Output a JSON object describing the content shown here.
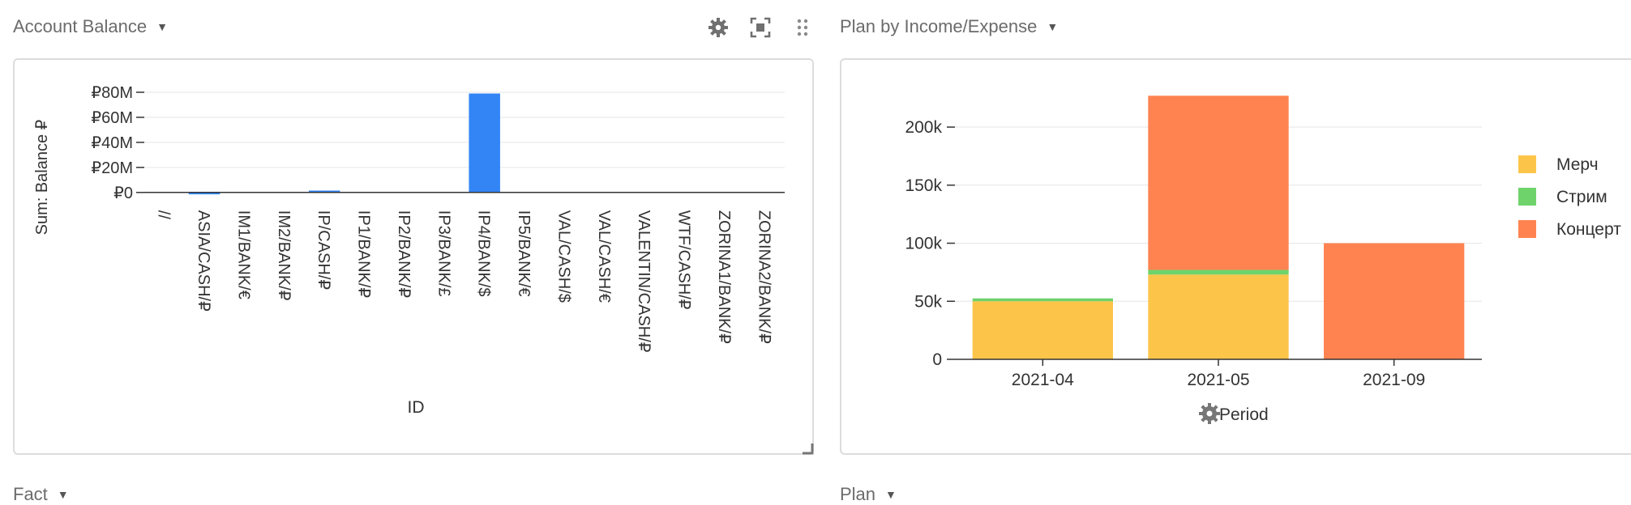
{
  "widgets": {
    "account_balance": {
      "title": "Account Balance"
    },
    "plan_income_expense": {
      "title": "Plan by Income/Expense"
    },
    "fact": {
      "title": "Fact"
    },
    "plan": {
      "title": "Plan"
    }
  },
  "toolbar": {
    "icons": [
      "gear-icon",
      "focus-icon",
      "drag-handle-icon"
    ]
  },
  "colors": {
    "bar_blue": "#3385f6",
    "merch": "#fcc54a",
    "stream": "#6fd36b",
    "concert": "#ff8350",
    "grid": "#e6e6e6",
    "axis": "#333333"
  },
  "chart_data": [
    {
      "type": "bar",
      "title": "Account Balance",
      "xlabel": "ID",
      "ylabel": "Sum: Balance ₽",
      "ylim": [
        -4000000,
        80000000
      ],
      "yticks": [
        0,
        20000000,
        40000000,
        60000000,
        80000000
      ],
      "ytick_labels": [
        "₽0",
        "₽20M",
        "₽40M",
        "₽60M",
        "₽80M"
      ],
      "categories": [
        "//",
        "ASIA/CASH/₽",
        "IM1/BANK/€",
        "IM2/BANK/₽",
        "IP/CASH/₽",
        "IP1/BANK/₽",
        "IP2/BANK/₽",
        "IP3/BANK/£",
        "IP4/BANK/$",
        "IP5/BANK/€",
        "VAL/CASH/$",
        "VAL/CASH/€",
        "VALENTIN/CASH/₽",
        "WTF/CASH/₽",
        "ZORINA1/BANK/₽",
        "ZORINA2/BANK/₽"
      ],
      "values": [
        0,
        -1500000,
        0,
        300000,
        1500000,
        400000,
        0,
        0,
        79000000,
        0,
        0,
        0,
        300000,
        0,
        0,
        0
      ],
      "grid": true,
      "legend": "none"
    },
    {
      "type": "bar",
      "stacked": true,
      "title": "Plan by Income/Expense",
      "xlabel": "Period",
      "ylabel": "",
      "ylim": [
        0,
        230000
      ],
      "yticks": [
        0,
        50000,
        100000,
        150000,
        200000
      ],
      "ytick_labels": [
        "0",
        "50k",
        "100k",
        "150k",
        "200k"
      ],
      "categories": [
        "2021-04",
        "2021-05",
        "2021-09"
      ],
      "series": [
        {
          "name": "Мерч",
          "values": [
            50000,
            73000,
            0
          ]
        },
        {
          "name": "Стрим",
          "values": [
            2500,
            4000,
            0
          ]
        },
        {
          "name": "Концерт",
          "values": [
            0,
            150000,
            100000
          ]
        }
      ],
      "grid": true,
      "legend": "right"
    }
  ]
}
